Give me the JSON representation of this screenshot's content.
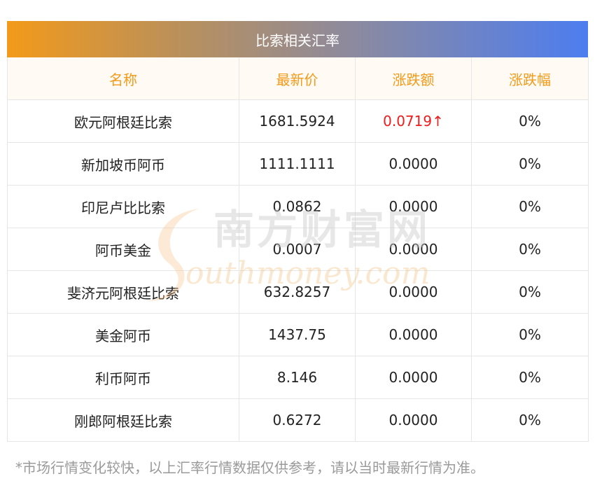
{
  "title": "比索相关汇率",
  "columns": [
    "名称",
    "最新价",
    "涨跌额",
    "涨跌幅"
  ],
  "rows": [
    {
      "name": "欧元阿根廷比索",
      "price": "1681.5924",
      "change": "0.0719↑",
      "pct": "0%",
      "up": true
    },
    {
      "name": "新加坡币阿币",
      "price": "1111.1111",
      "change": "0.0000",
      "pct": "0%",
      "up": false
    },
    {
      "name": "印尼卢比比索",
      "price": "0.0862",
      "change": "0.0000",
      "pct": "0%",
      "up": false
    },
    {
      "name": "阿币美金",
      "price": "0.0007",
      "change": "0.0000",
      "pct": "0%",
      "up": false
    },
    {
      "name": "斐济元阿根廷比索",
      "price": "632.8257",
      "change": "0.0000",
      "pct": "0%",
      "up": false
    },
    {
      "name": "美金阿币",
      "price": "1437.75",
      "change": "0.0000",
      "pct": "0%",
      "up": false
    },
    {
      "name": "利币阿币",
      "price": "8.146",
      "change": "0.0000",
      "pct": "0%",
      "up": false
    },
    {
      "name": "刚郎阿根廷比索",
      "price": "0.6272",
      "change": "0.0000",
      "pct": "0%",
      "up": false
    }
  ],
  "footnote": "*市场行情变化较快，以上汇率行情数据仅供参考，请以当时最新行情为准。",
  "watermark": {
    "cn": "南方财富网",
    "en": "outhmoney.com"
  },
  "colors": {
    "accent_orange": "#f39a1a",
    "accent_blue": "#4d7df0",
    "up_red": "#ee1c1c"
  }
}
